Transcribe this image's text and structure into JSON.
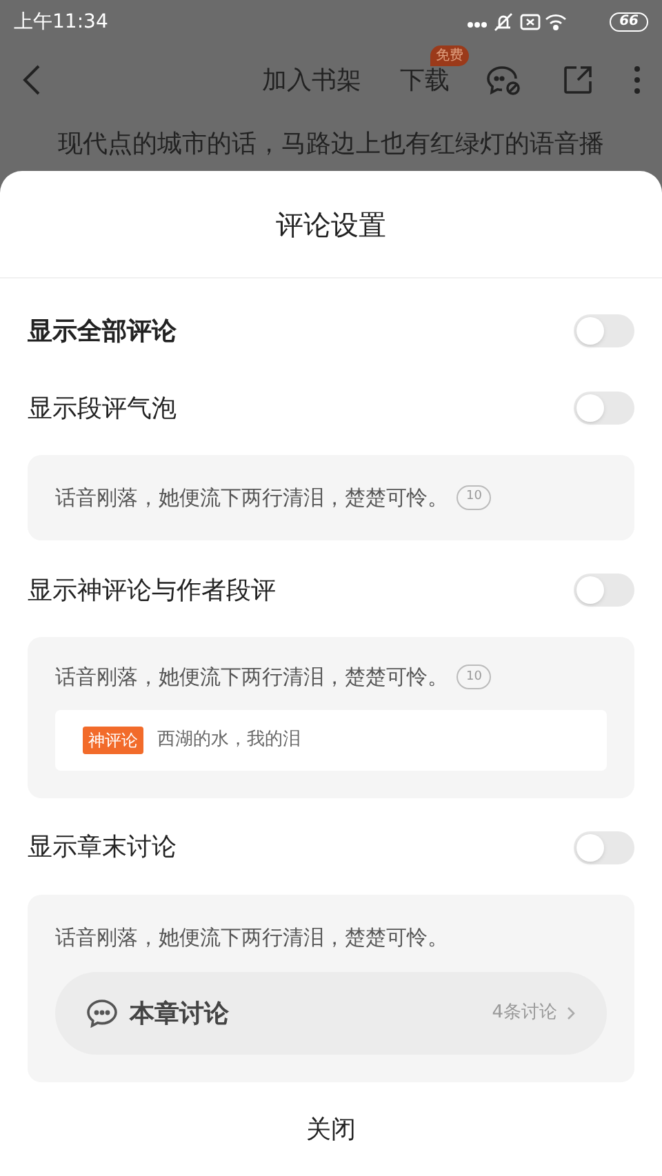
{
  "status_bar": {
    "time": "上午11:34",
    "battery": "66"
  },
  "top_bar": {
    "actions": [
      {
        "label": "加入书架"
      },
      {
        "label": "下载",
        "badge": "免费"
      }
    ]
  },
  "page_text": "现代点的城市的话，马路边上也有红绿灯的语音播",
  "sheet": {
    "title": "评论设置",
    "settings": [
      {
        "kind": "plain",
        "label": "显示全部评论",
        "on": false
      },
      {
        "kind": "bubble",
        "label": "显示段评气泡",
        "on": false,
        "preview": {
          "text": "话音刚落，她便流下两行清泪，楚楚可怜。",
          "count": "10"
        }
      },
      {
        "kind": "god",
        "label": "显示神评论与作者段评",
        "on": false,
        "preview": {
          "text": "话音刚落，她便流下两行清泪，楚楚可怜。",
          "count": "10",
          "tag": "神评论",
          "comment": "西湖的水，我的泪"
        }
      },
      {
        "kind": "chapter",
        "label": "显示章末讨论",
        "on": false,
        "preview": {
          "text": "话音刚落，她便流下两行清泪，楚楚可怜。",
          "discussion_title": "本章讨论",
          "discussion_count": "4条讨论"
        }
      }
    ],
    "close": "关闭"
  }
}
